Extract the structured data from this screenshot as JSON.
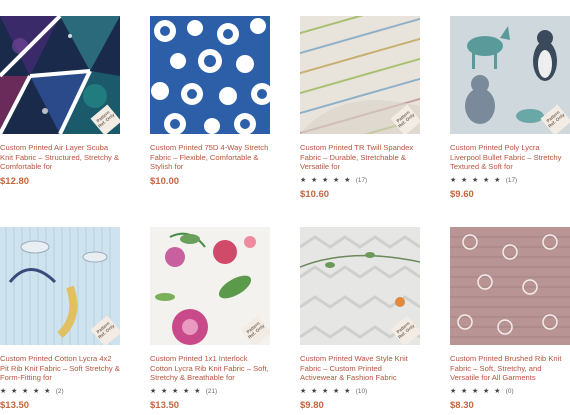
{
  "products": [
    {
      "title": "Custom Printed Air Layer Scuba Knit Fabric – Structured, Stretchy & Comfortable for",
      "price": "$12.80",
      "stars": "",
      "rating_count": "",
      "badge": "Pattern Ref. Only"
    },
    {
      "title": "Custom Printed 75D 4-Way Stretch Fabric – Flexible, Comfortable & Stylish for",
      "price": "$10.00",
      "stars": "",
      "rating_count": "",
      "badge": ""
    },
    {
      "title": "Custom Printed TR Twill Spandex Fabric – Durable, Stretchable & Versatile for",
      "price": "$10.60",
      "stars": "★ ★ ★ ★ ★",
      "rating_count": "(17)",
      "badge": "Pattern Ref. Only"
    },
    {
      "title": "Custom Printed Poly Lycra Liverpool Bullet Fabric – Stretchy Textured & Soft for",
      "price": "$9.60",
      "stars": "★ ★ ★ ★ ★",
      "rating_count": "(17)",
      "badge": "Pattern Ref. Only"
    },
    {
      "title": "Custom Printed Cotton Lycra 4x2 Pit Rib Knit Fabric – Soft Stretchy & Form-Fitting for",
      "price": "$13.50",
      "stars": "★ ★ ★ ★ ★",
      "rating_count": "(2)",
      "badge": "Pattern Ref. Only"
    },
    {
      "title": "Custom Printed 1x1 Interlock Cotton Lycra Rib Knit Fabric – Soft, Stretchy & Breathable for",
      "price": "$13.50",
      "stars": "★ ★ ★ ★ ★",
      "rating_count": "(21)",
      "badge": "Pattern Ref. Only"
    },
    {
      "title": "Custom Printed Wave Style Knit Fabric – Custom Printed Activewear & Fashion Fabric",
      "price": "$9.80",
      "stars": "★ ★ ★ ★ ★",
      "rating_count": "(10)",
      "badge": "Pattern Ref. Only"
    },
    {
      "title": "Custom Printed Brushed Rib Knit Fabric – Soft, Stretchy, and Versatile for All Garments",
      "price": "$8.30",
      "stars": "★ ★ ★ ★ ★",
      "rating_count": "(0)",
      "badge": ""
    }
  ],
  "colors": {
    "title": "#b8553e",
    "price": "#c4663f"
  }
}
